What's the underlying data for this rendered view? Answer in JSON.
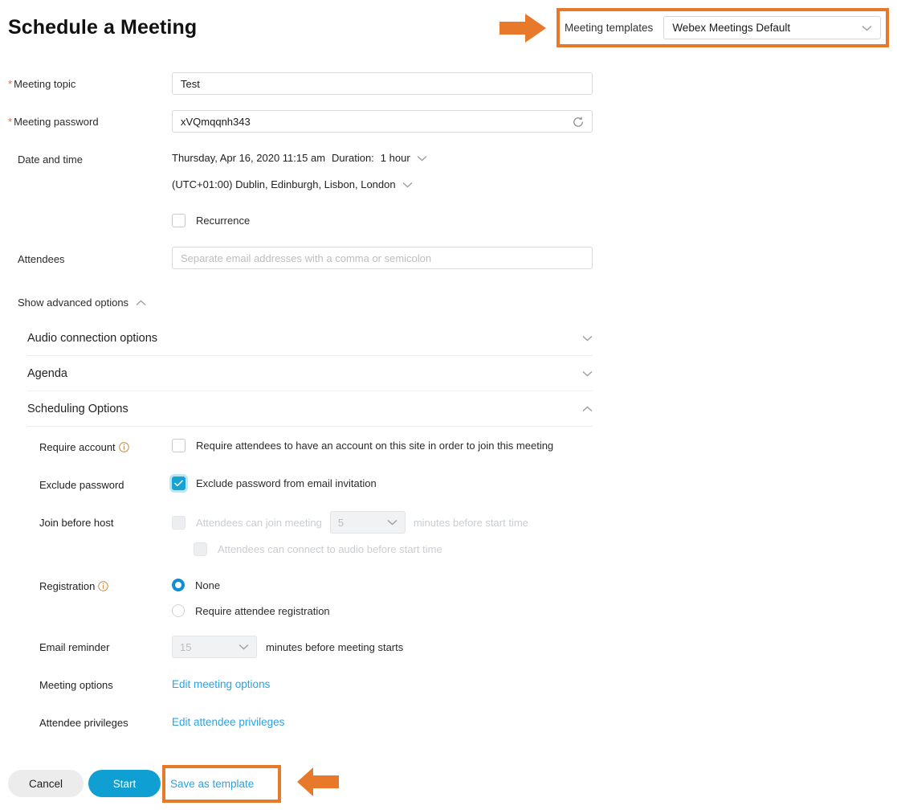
{
  "page": {
    "title": "Schedule a Meeting"
  },
  "template_bar": {
    "label": "Meeting templates",
    "selected": "Webex Meetings Default",
    "chevron_icon": "chevron-down-icon",
    "callout_arrow_icon": "arrow-right-icon",
    "highlight_color": "#e8792a"
  },
  "form": {
    "topic": {
      "label": "Meeting topic",
      "required_marker": "*",
      "value": "Test"
    },
    "password": {
      "label": "Meeting password",
      "required_marker": "*",
      "value": "xVQmqqnh343",
      "regenerate_icon": "refresh-icon"
    },
    "datetime": {
      "label": "Date and time",
      "date_value": "Thursday, Apr 16, 2020 11:15 am",
      "duration_label": "Duration:",
      "duration_value": "1 hour",
      "timezone_value": "(UTC+01:00) Dublin, Edinburgh, Lisbon, London",
      "recurrence_label": "Recurrence",
      "recurrence_checked": false
    },
    "attendees": {
      "label": "Attendees",
      "placeholder": "Separate email addresses with a comma or semicolon",
      "value": ""
    },
    "advanced_toggle": {
      "label": "Show advanced options",
      "icon": "chevron-up-icon",
      "expanded": true
    }
  },
  "accordion": [
    {
      "label": "Audio connection options",
      "icon": "chevron-down-icon",
      "expanded": false
    },
    {
      "label": "Agenda",
      "icon": "chevron-down-icon",
      "expanded": false
    },
    {
      "label": "Scheduling Options",
      "icon": "chevron-up-icon",
      "expanded": true
    }
  ],
  "scheduling_options": {
    "require_account": {
      "label": "Require account",
      "info_icon": "info-icon",
      "checkbox_label": "Require attendees to have an account on this site in order to join this meeting",
      "checked": false
    },
    "exclude_password": {
      "label": "Exclude password",
      "checkbox_label": "Exclude password from email invitation",
      "checked": true
    },
    "join_before_host": {
      "label": "Join before host",
      "checkbox_label_before": "Attendees can join meeting",
      "minutes_value": "5",
      "checkbox_label_after": "minutes before start time",
      "audio_label": "Attendees can connect to audio before start time",
      "checked": false,
      "disabled": true
    },
    "registration": {
      "label": "Registration",
      "info_icon": "info-icon",
      "options": [
        {
          "label": "None",
          "selected": true
        },
        {
          "label": "Require attendee registration",
          "selected": false
        }
      ]
    },
    "email_reminder": {
      "label": "Email reminder",
      "minutes_value": "15",
      "suffix": "minutes before meeting starts",
      "disabled": true
    },
    "meeting_options": {
      "label": "Meeting options",
      "link": "Edit meeting options"
    },
    "attendee_privileges": {
      "label": "Attendee privileges",
      "link": "Edit attendee privileges"
    }
  },
  "footer": {
    "cancel_label": "Cancel",
    "start_label": "Start",
    "save_template_label": "Save as template",
    "callout_arrow_icon": "arrow-left-icon",
    "highlight_color": "#e8792a"
  }
}
